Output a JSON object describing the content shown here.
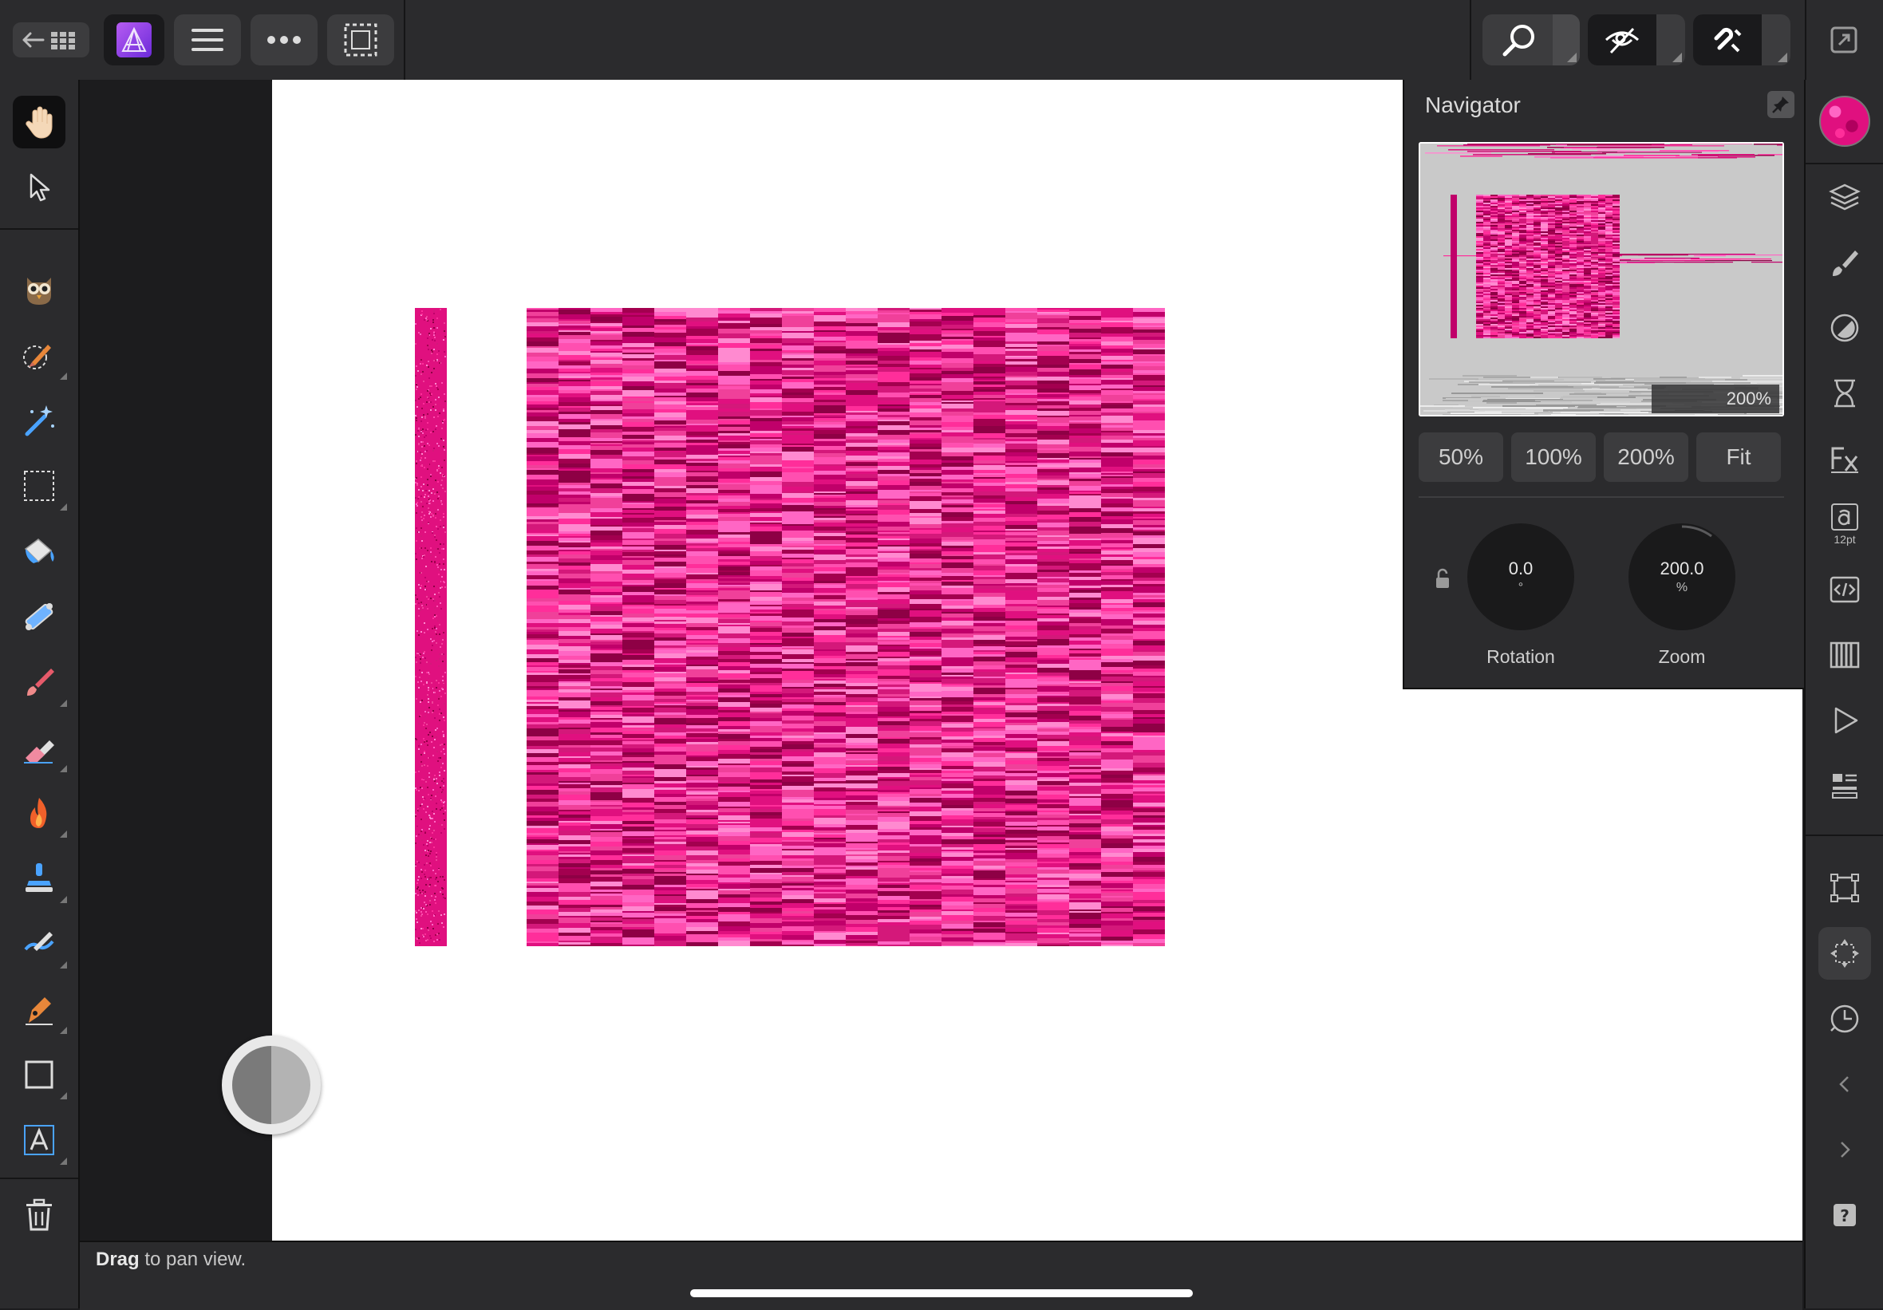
{
  "topbar": {
    "back_icon": "back-arrow-grid-icon",
    "app_icon": "affinity-photo-icon",
    "menu_icon": "hamburger-menu-icon",
    "more_icon": "more-dots-icon",
    "selection_icon": "selection-marquee-icon",
    "zoom_icon": "zoom-icon",
    "view_mode_icon": "view-mode-icon",
    "snapping_icon": "snapping-magnet-icon",
    "fullscreen_icon": "expand-icon"
  },
  "left_tools": [
    "hand-tool",
    "move-tool",
    "paint-mixer-brush-tool",
    "selection-brush-tool",
    "flood-select-tool",
    "rectangular-marquee-tool",
    "flood-fill-tool",
    "gradient-tool",
    "paint-brush-tool",
    "erase-brush-tool",
    "burn-brush-tool",
    "clone-brush-tool",
    "smudge-brush-tool",
    "pen-tool",
    "rectangle-tool",
    "artistic-text-tool",
    "delete"
  ],
  "accent_colors": {
    "pink": "#e0107f",
    "dark_ui": "#2b2b2d",
    "canvas": "#ffffff"
  },
  "navigator": {
    "title": "Navigator",
    "preview_zoom_label": "200%",
    "zoom_buttons": [
      "50%",
      "100%",
      "200%",
      "Fit"
    ],
    "rotation": {
      "value": "0.0",
      "unit": "°",
      "label": "Rotation"
    },
    "zoom": {
      "value": "200.0",
      "unit": "%",
      "label": "Zoom"
    }
  },
  "right_studio": {
    "text_size_label": "12pt",
    "icons": [
      "layers-icon",
      "brushes-icon",
      "adjustments-icon",
      "history-hourglass-icon",
      "fx-icon",
      "text-styles-icon",
      "macro-code-icon",
      "channels-icon",
      "play-icon",
      "panels-icon",
      "transform-icon",
      "navigator-icon",
      "time-clock-icon",
      "collapse-left-icon",
      "expand-right-icon",
      "help-icon"
    ]
  },
  "status": {
    "hint_bold": "Drag",
    "hint_rest": " to pan view."
  }
}
